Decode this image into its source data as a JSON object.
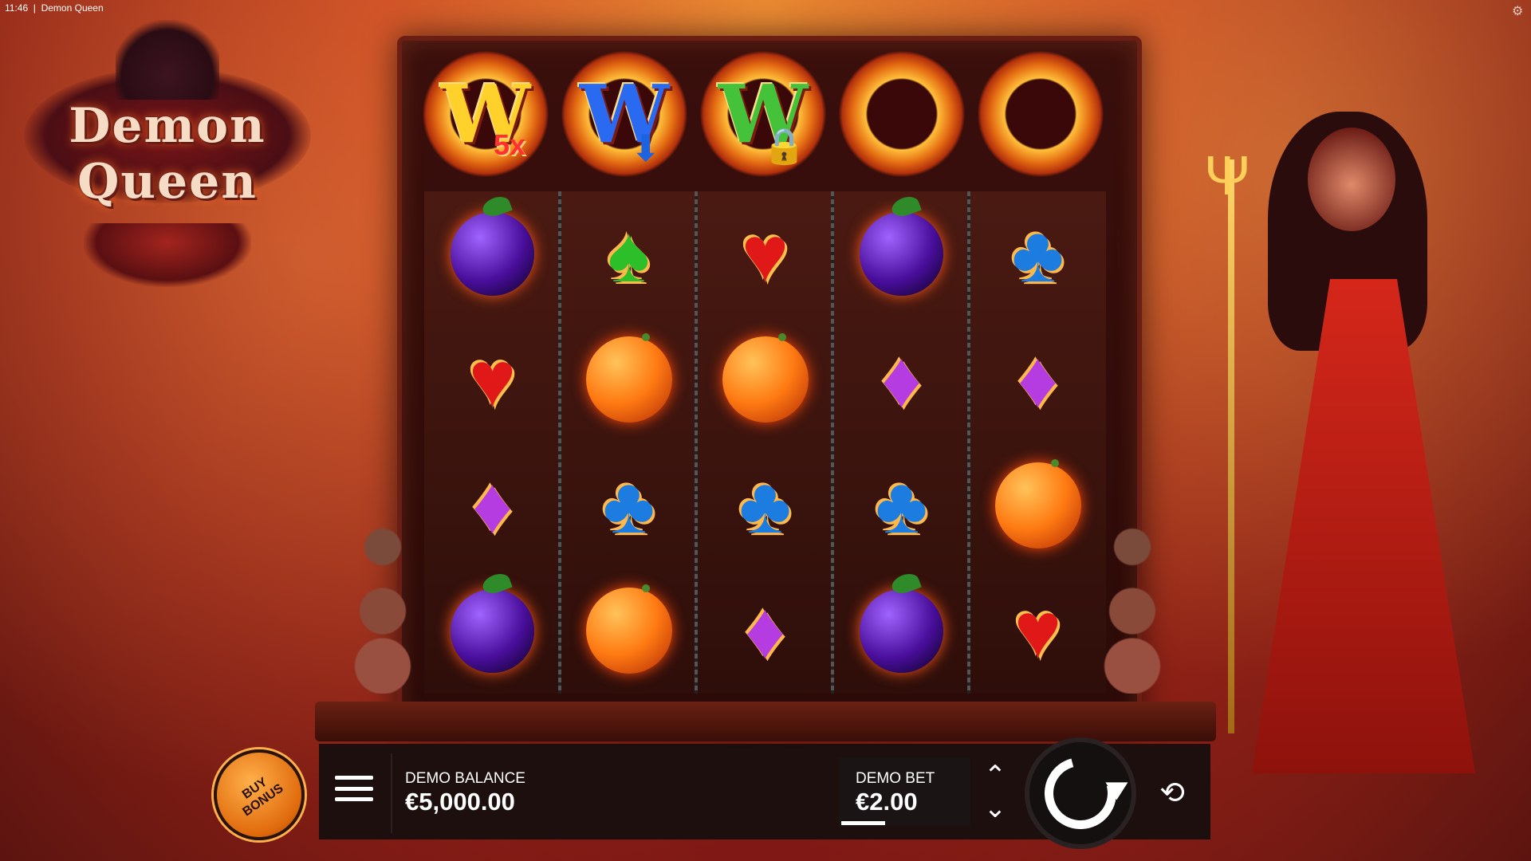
{
  "status": {
    "time": "11:46",
    "title": "Demon Queen"
  },
  "icons": {
    "settings": "settings-icon",
    "menu": "hamburger-menu-icon",
    "spin": "spin-arrow-icon",
    "autoplay": "autoplay-icon",
    "bet_up": "chevron-up-icon",
    "bet_down": "chevron-down-icon"
  },
  "logo": {
    "line1": "Demon",
    "line2": "Queen"
  },
  "wilds": [
    {
      "letter": "W",
      "color": "#ffd12a",
      "modifier": "5x"
    },
    {
      "letter": "W",
      "color": "#2a6af0",
      "modifier": "arrow-down"
    },
    {
      "letter": "W",
      "color": "#43c23a",
      "modifier": "lock"
    },
    {
      "letter": "",
      "color": "",
      "modifier": ""
    },
    {
      "letter": "",
      "color": "",
      "modifier": ""
    }
  ],
  "reels": [
    [
      "plum",
      "spade",
      "heart",
      "plum",
      "club"
    ],
    [
      "heart",
      "orange",
      "orange",
      "diamond",
      "diamond"
    ],
    [
      "diamond",
      "club",
      "club",
      "club",
      "orange"
    ],
    [
      "plum",
      "orange",
      "diamond",
      "plum",
      "heart"
    ]
  ],
  "controls": {
    "buy_bonus": "BUY\nBONUS",
    "balance_label": "DEMO BALANCE",
    "balance_value": "€5,000.00",
    "bet_label": "DEMO BET",
    "bet_value": "€2.00"
  }
}
